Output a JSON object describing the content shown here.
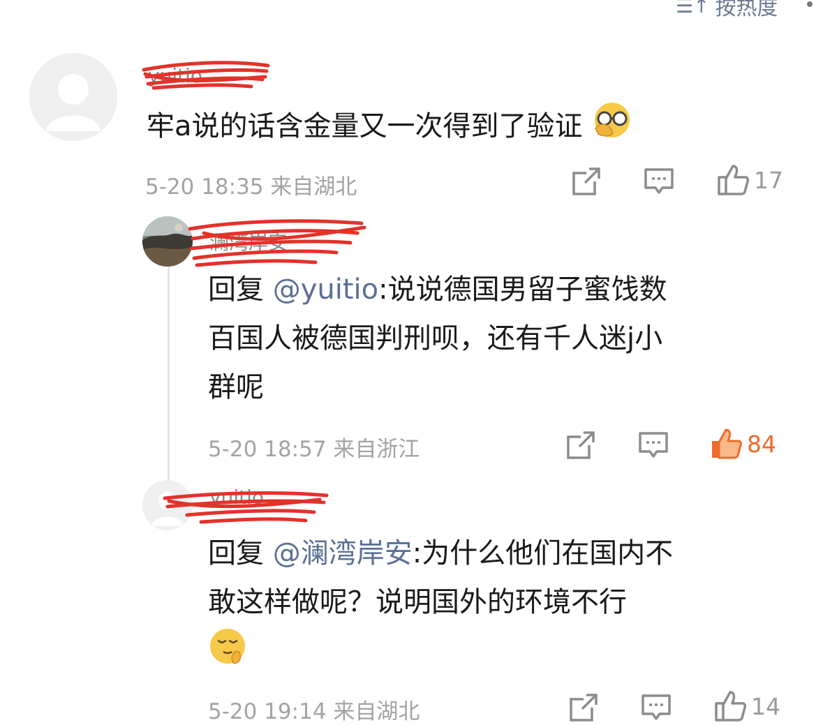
{
  "sort": {
    "icon": "sort-icon",
    "label": "按热度"
  },
  "colors": {
    "mention": "#5b6f94",
    "liked": "#ee6a2c",
    "meta": "#a3a3a3",
    "redaction": "#e3322a"
  },
  "comments": [
    {
      "username": "yuitio",
      "text": "牢a说的话含金量又一次得到了验证",
      "emoji": "facepalm-emoji",
      "time": "5-20 18:35",
      "location": "来自湖北",
      "likes": "17",
      "liked": false,
      "replies": [
        {
          "username": "澜湾岸安",
          "reply_prefix": "回复 ",
          "mention": "@yuitio",
          "line1": ":说说德国男留子蜜饯数",
          "line2": "百国人被德国判刑呗，还有千人迷j小",
          "line3": "群呢",
          "time": "5-20 18:57",
          "location": "来自浙江",
          "likes": "84",
          "liked": true
        },
        {
          "username": "yuitio",
          "reply_prefix": "回复 ",
          "mention": "@澜湾岸安",
          "line1": ":为什么他们在国内不",
          "line2": "敢这样做呢？说明国外的环境不行",
          "emoji": "shush-emoji",
          "time": "5-20 19:14",
          "location": "来自湖北",
          "likes": "14",
          "liked": false
        }
      ]
    }
  ]
}
